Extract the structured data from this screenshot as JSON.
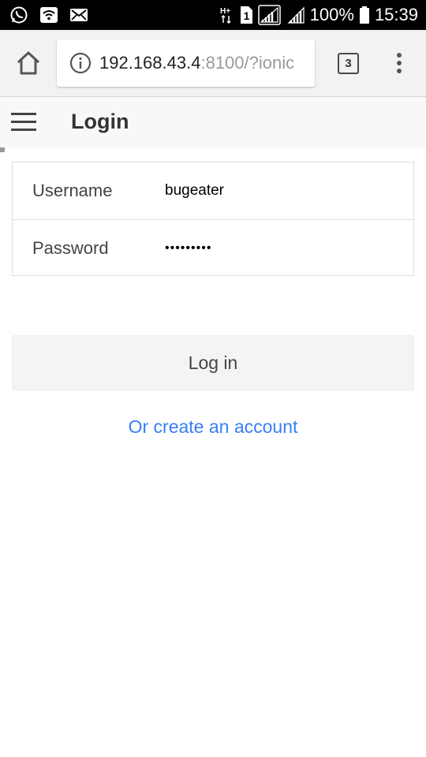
{
  "status_bar": {
    "battery": "100%",
    "time": "15:39",
    "sim_slot": "1",
    "network_type": "H+",
    "icons": [
      "whatsapp-icon",
      "wifi-icon",
      "mail-icon",
      "network-type-icon",
      "sim-icon",
      "signal-icon",
      "signal-icon",
      "battery-icon"
    ]
  },
  "browser": {
    "url_host": "192.168.43.4",
    "url_rest": ":8100/?ionic",
    "tab_count": "3",
    "icons": [
      "home-icon",
      "info-icon",
      "overflow-menu-icon"
    ]
  },
  "header": {
    "title": "Login"
  },
  "form": {
    "username_label": "Username",
    "username_value": "bugeater",
    "password_label": "Password",
    "password_value": "fakepass1"
  },
  "actions": {
    "login_label": "Log in",
    "create_account_label": "Or create an account"
  },
  "colors": {
    "status_bar_bg": "#000000",
    "browser_bar_bg": "#f2f2f2",
    "link": "#387ef5",
    "button_bg": "#f4f4f4"
  }
}
